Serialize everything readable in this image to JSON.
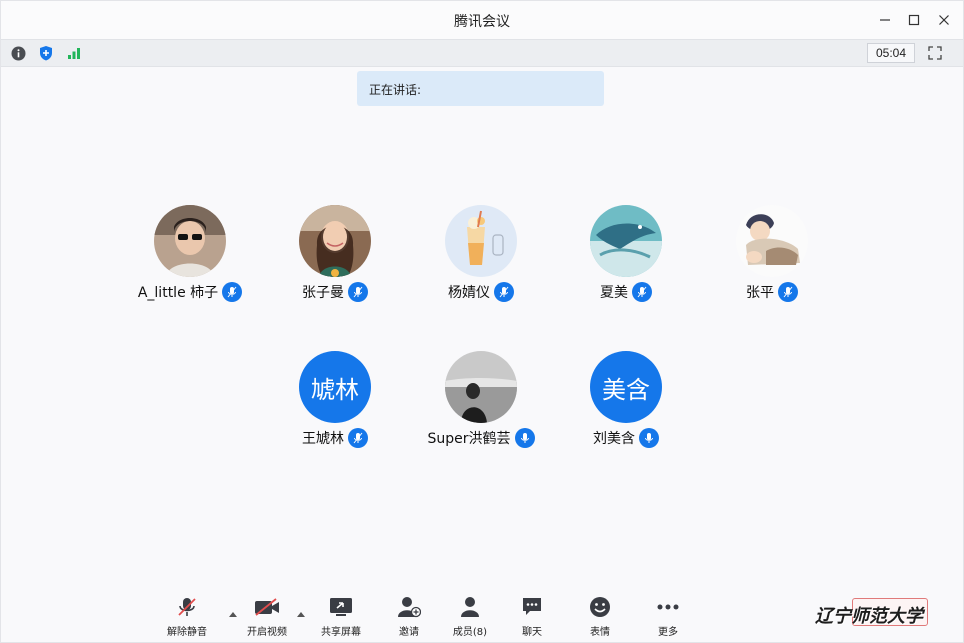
{
  "window": {
    "title": "腾讯会议"
  },
  "status": {
    "timer": "05:04"
  },
  "speaking": {
    "label": "正在讲话:"
  },
  "participants": [
    {
      "name": "A_little 柿子",
      "avatar": "photo-girl-sunglasses"
    },
    {
      "name": "张子曼",
      "avatar": "photo-girl-smiling"
    },
    {
      "name": "杨婧仪",
      "avatar": "drink-illustration"
    },
    {
      "name": "夏美",
      "avatar": "whale-illustration"
    },
    {
      "name": "张平",
      "avatar": "anime-character"
    },
    {
      "name": "王虓林",
      "avatar_text": "虓林"
    },
    {
      "name": "Super洪鹤芸",
      "avatar": "photo-person-seaside"
    },
    {
      "name": "刘美含",
      "avatar_text": "美含"
    }
  ],
  "toolbar": {
    "unmute": "解除静音",
    "start_video": "开启视频",
    "share_screen": "共享屏幕",
    "invite": "邀请",
    "members": "成员(8)",
    "chat": "聊天",
    "emoji": "表情",
    "more": "更多"
  },
  "watermark": "辽宁师范大学",
  "colors": {
    "accent": "#1577ea",
    "banner": "#dbeaf9",
    "signal": "#22b55a"
  }
}
